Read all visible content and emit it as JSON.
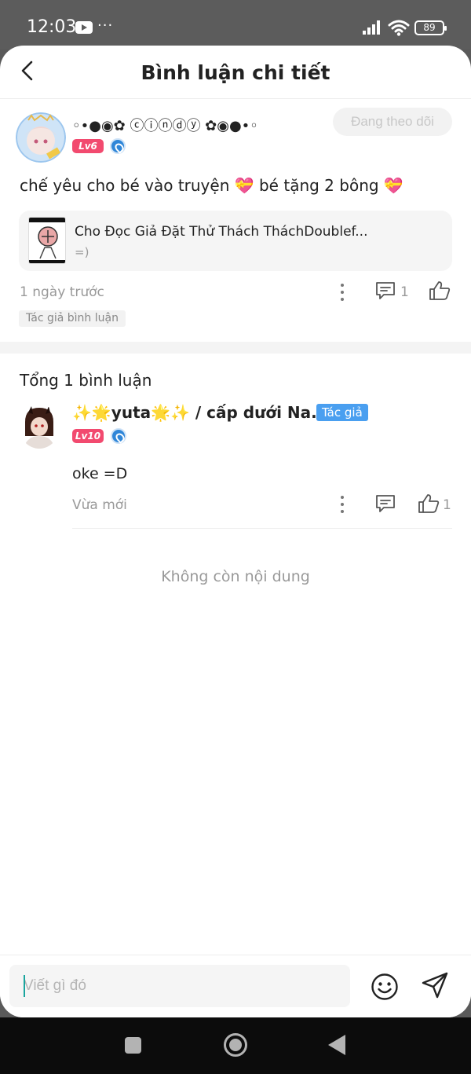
{
  "status_bar": {
    "time": "12:03",
    "more": "···",
    "battery": "89"
  },
  "header": {
    "title": "Bình luận chi tiết"
  },
  "main_comment": {
    "username": "◦•●◉✿ ⓒⓘⓝⓓⓨ ✿◉●•◦",
    "level": "Lv6",
    "follow_label": "Đang theo dõi",
    "text": "chế yêu cho bé vào truyện 💝 bé tặng 2 bông 💝",
    "story": {
      "title": "Cho Đọc Giả Đặt Thử Thách TháchDoublef...",
      "subtitle": "=)"
    },
    "time": "1 ngày trước",
    "reply_count": "1",
    "author_tag": "Tác giả bình luận"
  },
  "replies_section": {
    "total_label": "Tổng 1 bình luận",
    "replies": [
      {
        "username": "✨🌟yuta🌟✨ / cấp dưới Na...",
        "author_badge": "Tác giả",
        "level": "Lv10",
        "text": "oke =D",
        "time": "Vừa mới",
        "like_count": "1"
      }
    ],
    "end_label": "Không còn nội dung"
  },
  "input": {
    "placeholder": "Viết gì đó"
  },
  "colors": {
    "level_badge": "#f24a6f",
    "author_badge": "#4a9ff0",
    "verified": "#2f86d8",
    "caret": "#1aa59e"
  }
}
